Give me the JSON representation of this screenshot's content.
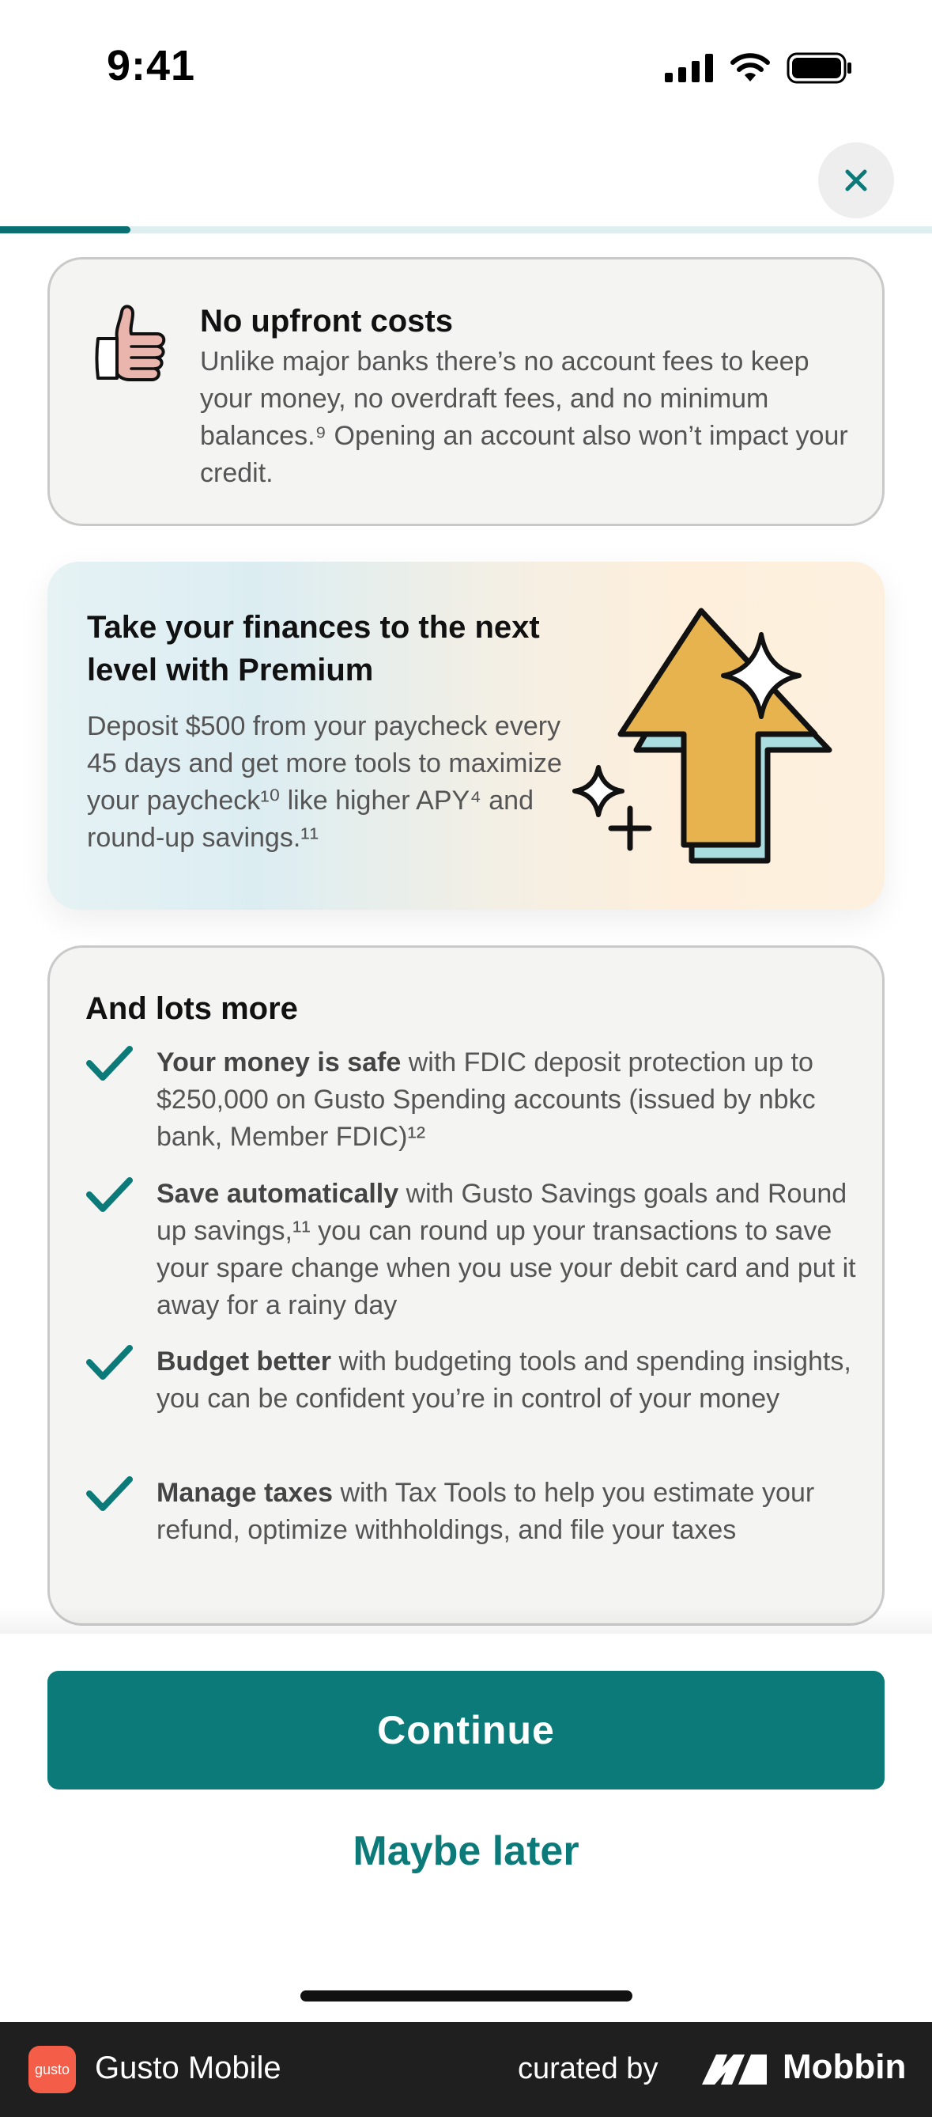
{
  "status_bar": {
    "time": "9:41"
  },
  "progress": {
    "fraction": 0.14
  },
  "costs_card": {
    "title": "No upfront costs",
    "body": "Unlike major banks there’s no account fees to keep your money, no overdraft fees, and no minimum balances.⁹ Opening an account also won’t impact your credit."
  },
  "premium_card": {
    "title": "Take your finances to the next level with Premium",
    "body": "Deposit $500 from your paycheck every 45 days and get more tools to maximize your paycheck¹⁰ like higher APY⁴ and round-up savings.¹¹"
  },
  "more_card": {
    "title": "And lots more",
    "features": [
      {
        "bold": "Your money is safe",
        "text": " with FDIC deposit protection up to $250,000 on Gusto Spending accounts (issued by nbkc bank, Member FDIC)¹²"
      },
      {
        "bold": "Save automatically",
        "text": " with Gusto Savings goals and Round up savings,¹¹ you can round up your transactions to save your spare change when you use your debit card and put it away for a rainy day"
      },
      {
        "bold": "Budget better",
        "text": " with budgeting tools and spending insights, you can be confident you’re in control of your money"
      },
      {
        "bold": "Manage taxes",
        "text": " with Tax Tools to help you estimate your refund, optimize withholdings, and file your taxes"
      }
    ]
  },
  "actions": {
    "continue_label": "Continue",
    "later_label": "Maybe later"
  },
  "footer": {
    "app_logo_text": "gusto",
    "app_name": "Gusto Mobile",
    "curated_by": "curated by",
    "brand": "Mobbin"
  },
  "colors": {
    "accent": "#0b7a79",
    "progress": "#0a6f73",
    "card_bg": "#f4f4f3"
  },
  "icons": [
    "signal-icon",
    "wifi-icon",
    "battery-icon",
    "close-icon",
    "thumbs-up-icon",
    "arrow-up-sparkle-icon",
    "check-icon",
    "mobbin-logo-icon"
  ]
}
